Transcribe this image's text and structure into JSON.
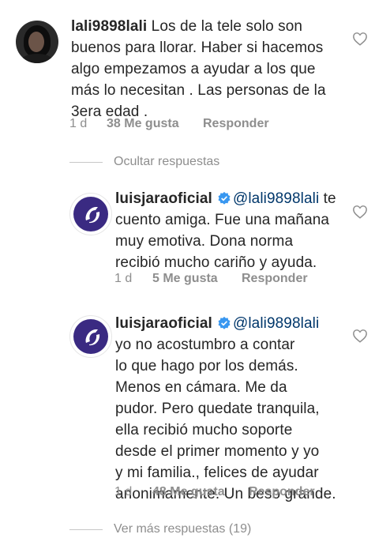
{
  "comment": {
    "username": "lali9898lali",
    "text_lines": [
      "Los de la tele solo son",
      "buenos para llorar. Haber si hacemos",
      "algo empezamos a ayudar a los que",
      "más lo necesitan . Las personas de la",
      "3era edad ."
    ],
    "time": "1 d",
    "likes": "38 Me gusta",
    "reply": "Responder",
    "avatar_icon": "user-photo"
  },
  "replies_toggle": "Ocultar respuestas",
  "replies": [
    {
      "username": "luisjaraoficial",
      "mention": "@lali9898lali",
      "first_line_rest": " te",
      "text_lines": [
        "cuento amiga. Fue una mañana",
        "muy emotiva. Dona norma",
        "recibió mucho cariño y ayuda."
      ],
      "time": "1 d",
      "likes": "5 Me gusta",
      "reply": "Responder",
      "avatar_icon": "logo-avatar"
    },
    {
      "username": "luisjaraoficial",
      "mention": "@lali9898lali",
      "first_line_rest": "",
      "text_lines": [
        "yo no acostumbro a contar",
        "lo que hago por los demás.",
        "Menos en cámara. Me da",
        "pudor. Pero quedate tranquila,",
        "ella recibió mucho soporte",
        "desde el primer momento y yo",
        "y mi familia., felices de ayudar",
        "anonimamente. Un beso grande."
      ],
      "time": "1 d",
      "likes": "48 Me gusta",
      "reply": "Responder",
      "avatar_icon": "logo-avatar"
    }
  ],
  "more_replies": "Ver más respuestas (19)",
  "colors": {
    "text": "#262626",
    "meta": "#8e8e8e",
    "mention": "#00376b",
    "verified": "#3897f0",
    "logo": "#3a2a82"
  }
}
